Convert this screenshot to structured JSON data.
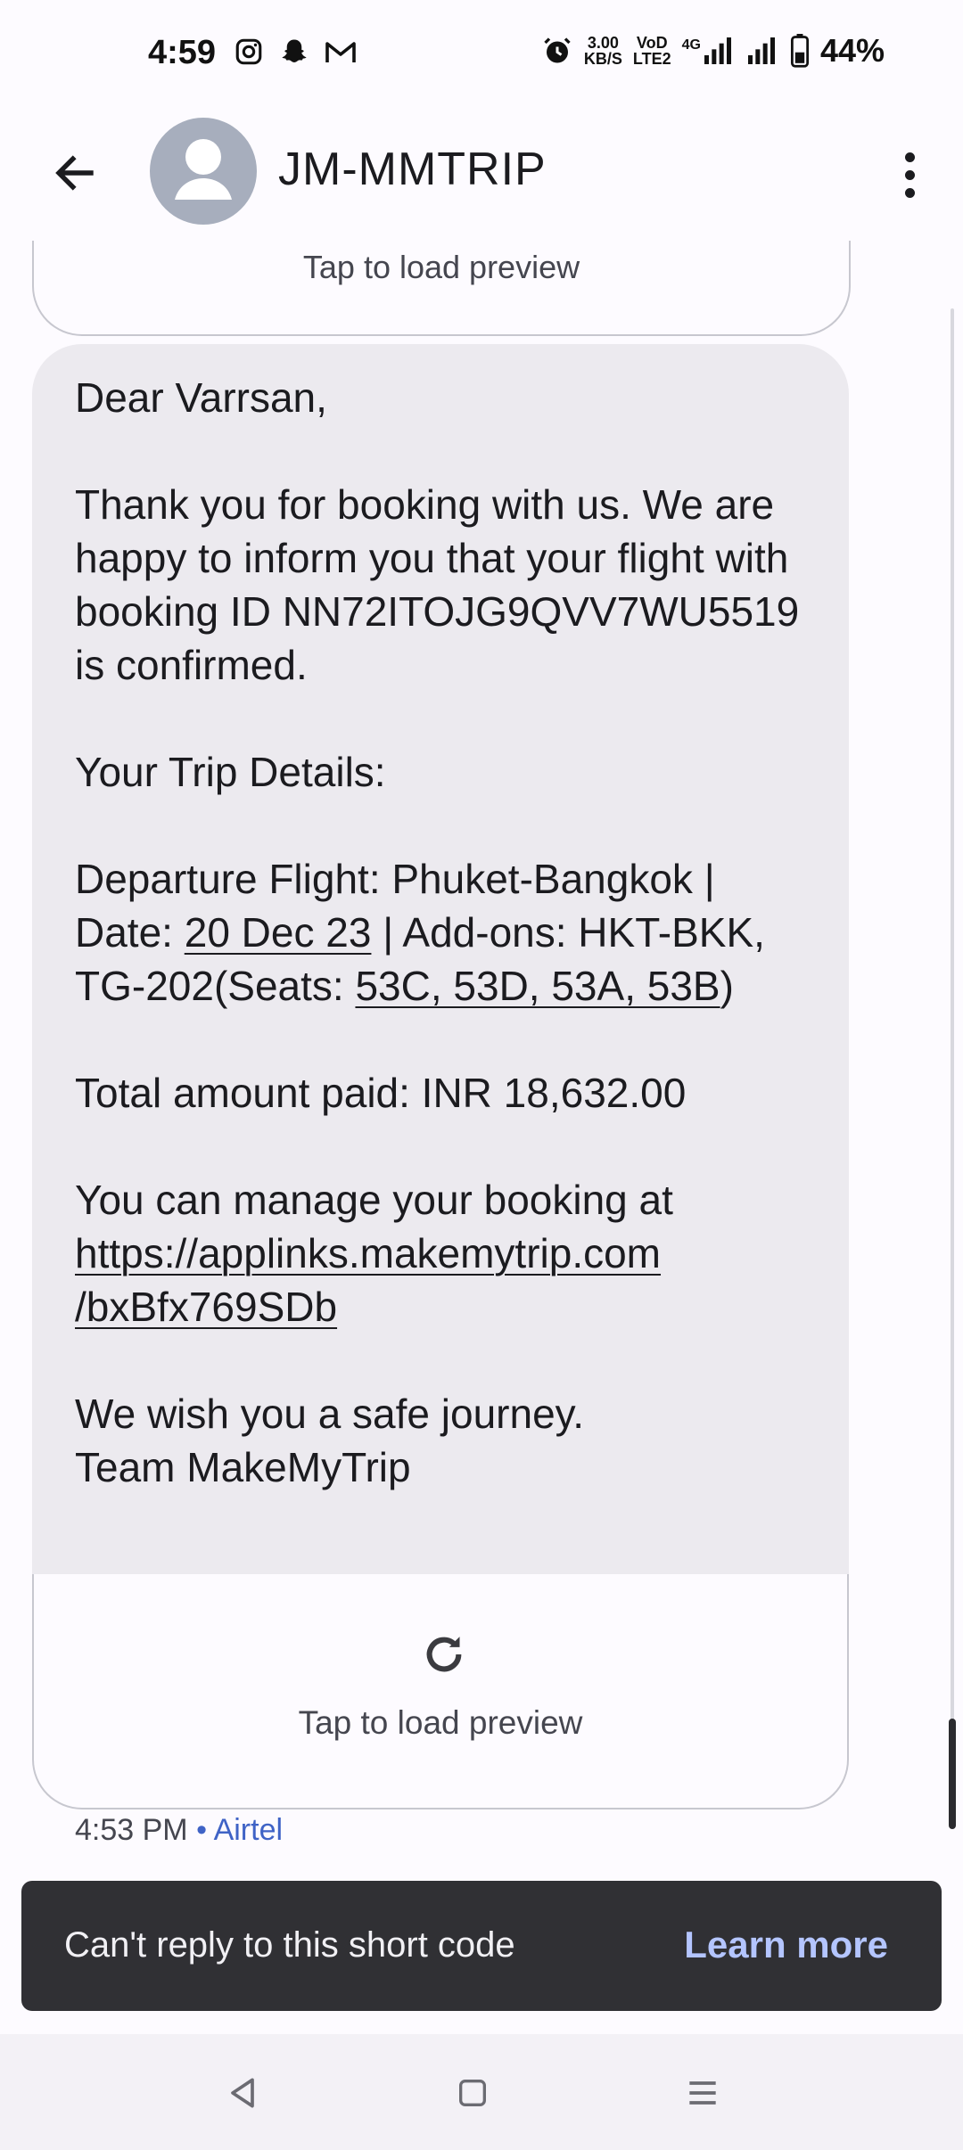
{
  "status_bar": {
    "time": "4:59",
    "notification_icons": [
      "instagram-icon",
      "snapchat-icon",
      "gmail-icon"
    ],
    "alarm_icon": "alarm-icon",
    "net_speed_value": "3.00",
    "net_speed_unit": "KB/S",
    "volte_label_top": "VoD",
    "volte_label_bottom": "LTE2",
    "network_type": "4G",
    "battery_percent": "44%"
  },
  "app_bar": {
    "back_icon": "arrow-back-icon",
    "contact_name": "JM-MMTRIP",
    "avatar_icon": "person-avatar-icon",
    "more_icon": "more-vert-icon"
  },
  "previous_card": {
    "label": "Tap to load preview"
  },
  "message": {
    "greeting": "Dear Varrsan,",
    "para1": "Thank you for booking with us. We are happy to inform you that your flight with booking ID NN72ITOJG9QVV7WU5519 is confirmed.",
    "trip_heading": "Your Trip Details:",
    "departure_prefix": "Departure Flight: Phuket-Bangkok | Date: ",
    "departure_date": "20 Dec 23",
    "departure_mid": " | Add-ons: HKT-BKK, TG-202(Seats: ",
    "seats": "53C, 53D, 53A, 53B",
    "departure_suffix": ")",
    "total": "Total amount paid: INR 18,632.00",
    "manage_text": "You can manage your booking at",
    "manage_link_line1": "https://applinks.makemytrip.com",
    "manage_link_line2": "/bxBfx769SDb",
    "closing1": "We wish you a safe journey.",
    "closing2": "Team MakeMyTrip"
  },
  "link_preview": {
    "icon": "refresh-icon",
    "label": "Tap to load preview"
  },
  "meta": {
    "time": "4:53 PM",
    "separator": "•",
    "carrier": "Airtel"
  },
  "snackbar": {
    "text": "Can't reply to this short code",
    "action": "Learn more"
  },
  "nav_bar": {
    "back": "nav-back-icon",
    "home": "nav-home-icon",
    "recents": "nav-menu-icon"
  }
}
